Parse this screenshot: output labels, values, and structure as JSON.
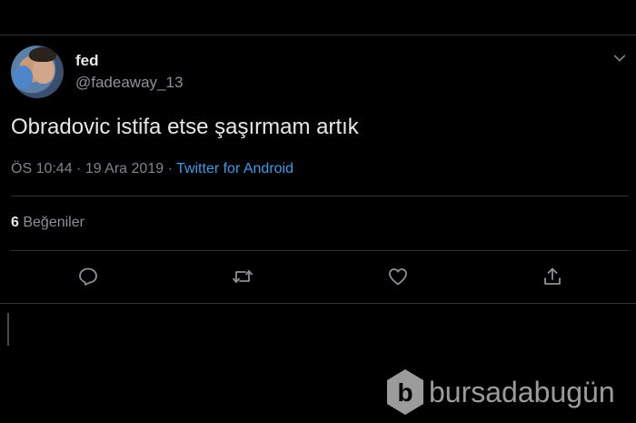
{
  "tweet": {
    "display_name": "fed",
    "handle": "@fadeaway_13",
    "text": "Obradovic istifa etse şaşırmam artık",
    "timestamp": "ÖS 10:44 · 19 Ara 2019 ·",
    "source": "Twitter for Android",
    "likes_count": "6",
    "likes_label": "Beğeniler"
  },
  "actions": [
    {
      "icon": "reply-icon"
    },
    {
      "icon": "retweet-icon"
    },
    {
      "icon": "like-icon"
    },
    {
      "icon": "share-icon"
    }
  ],
  "watermark": {
    "text": "bursadabugün",
    "logo_letter": "b"
  },
  "colors": {
    "background": "#000000",
    "link": "#3d9be9",
    "muted": "#8b9298",
    "divider": "#2f3336"
  }
}
